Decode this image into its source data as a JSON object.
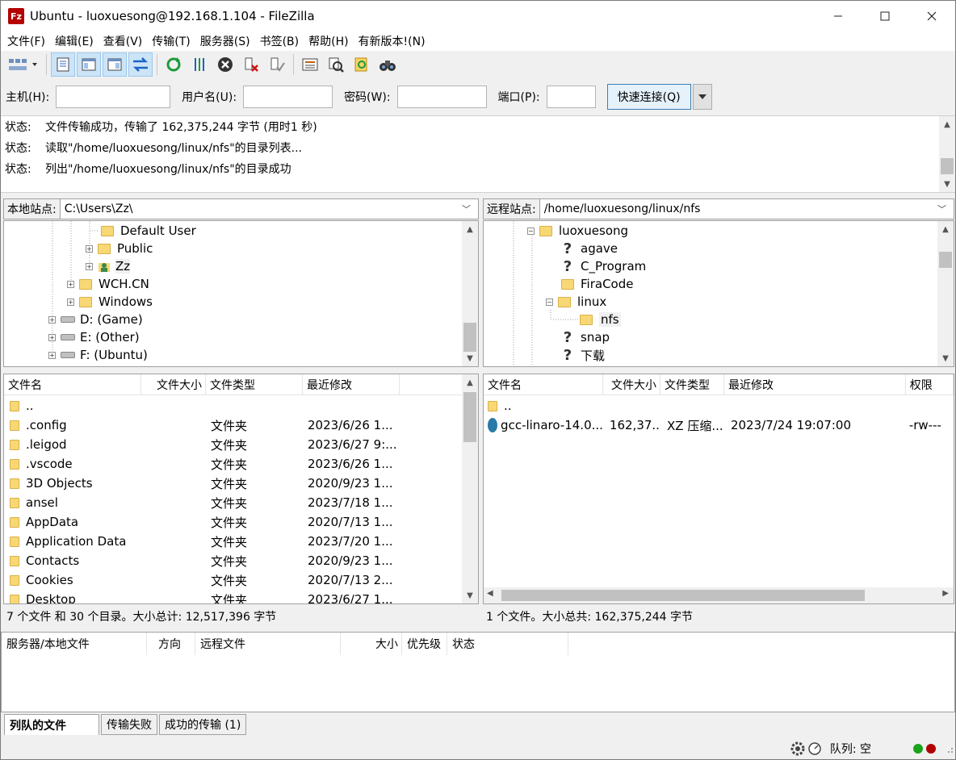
{
  "window": {
    "title": "Ubuntu - luoxuesong@192.168.1.104 - FileZilla",
    "app_icon_text": "Fz"
  },
  "menu": [
    "文件(F)",
    "编辑(E)",
    "查看(V)",
    "传输(T)",
    "服务器(S)",
    "书签(B)",
    "帮助(H)",
    "有新版本!(N)"
  ],
  "quickconnect": {
    "host_label": "主机(H):",
    "host_value": "",
    "user_label": "用户名(U):",
    "user_value": "",
    "pass_label": "密码(W):",
    "pass_value": "",
    "port_label": "端口(P):",
    "port_value": "",
    "connect_label": "快速连接(Q)"
  },
  "log": [
    {
      "label": "状态:",
      "text": "文件传输成功，传输了 162,375,244 字节 (用时1 秒)"
    },
    {
      "label": "状态:",
      "text": "读取\"/home/luoxuesong/linux/nfs\"的目录列表..."
    },
    {
      "label": "状态:",
      "text": "列出\"/home/luoxuesong/linux/nfs\"的目录成功"
    }
  ],
  "local": {
    "site_label": "本地站点:",
    "path": "C:\\Users\\Zz\\",
    "tree": [
      "Default User",
      "Public",
      "Zz",
      "WCH.CN",
      "Windows",
      "D: (Game)",
      "E: (Other)",
      "F: (Ubuntu)"
    ],
    "columns": [
      "文件名",
      "文件大小",
      "文件类型",
      "最近修改"
    ],
    "files": [
      {
        "name": "..",
        "size": "",
        "type": "",
        "modified": ""
      },
      {
        "name": ".config",
        "size": "",
        "type": "文件夹",
        "modified": "2023/6/26 1..."
      },
      {
        "name": ".leigod",
        "size": "",
        "type": "文件夹",
        "modified": "2023/6/27 9:..."
      },
      {
        "name": ".vscode",
        "size": "",
        "type": "文件夹",
        "modified": "2023/6/26 1..."
      },
      {
        "name": "3D Objects",
        "size": "",
        "type": "文件夹",
        "modified": "2020/9/23 1..."
      },
      {
        "name": "ansel",
        "size": "",
        "type": "文件夹",
        "modified": "2023/7/18 1..."
      },
      {
        "name": "AppData",
        "size": "",
        "type": "文件夹",
        "modified": "2020/7/13 1..."
      },
      {
        "name": "Application Data",
        "size": "",
        "type": "文件夹",
        "modified": "2023/7/20 1..."
      },
      {
        "name": "Contacts",
        "size": "",
        "type": "文件夹",
        "modified": "2020/9/23 1..."
      },
      {
        "name": "Cookies",
        "size": "",
        "type": "文件夹",
        "modified": "2020/7/13 2..."
      },
      {
        "name": "Desktop",
        "size": "",
        "type": "文件夹",
        "modified": "2023/6/27 1..."
      }
    ],
    "status": "7 个文件 和 30 个目录。大小总计: 12,517,396 字节"
  },
  "remote": {
    "site_label": "远程站点:",
    "path": "/home/luoxuesong/linux/nfs",
    "tree": [
      "luoxuesong",
      "agave",
      "C_Program",
      "FiraCode",
      "linux",
      "nfs",
      "snap",
      "下载"
    ],
    "columns": [
      "文件名",
      "文件大小",
      "文件类型",
      "最近修改",
      "权限"
    ],
    "files": [
      {
        "name": "..",
        "size": "",
        "type": "",
        "modified": "",
        "perm": ""
      },
      {
        "name": "gcc-linaro-14.0...",
        "size": "162,37...",
        "type": "XZ 压缩...",
        "modified": "2023/7/24 19:07:00",
        "perm": "-rw---"
      }
    ],
    "status": "1 个文件。大小总共: 162,375,244 字节"
  },
  "queue": {
    "columns": [
      "服务器/本地文件",
      "方向",
      "远程文件",
      "大小",
      "优先级",
      "状态"
    ],
    "tabs": [
      "列队的文件",
      "传输失败",
      "成功的传输 (1)"
    ]
  },
  "statusbar": {
    "queue_text": "队列: 空"
  },
  "colors": {
    "folder": "#f8d775",
    "accent": "#cce4f7",
    "led_green": "#1aa31a",
    "led_red": "#b00000"
  }
}
